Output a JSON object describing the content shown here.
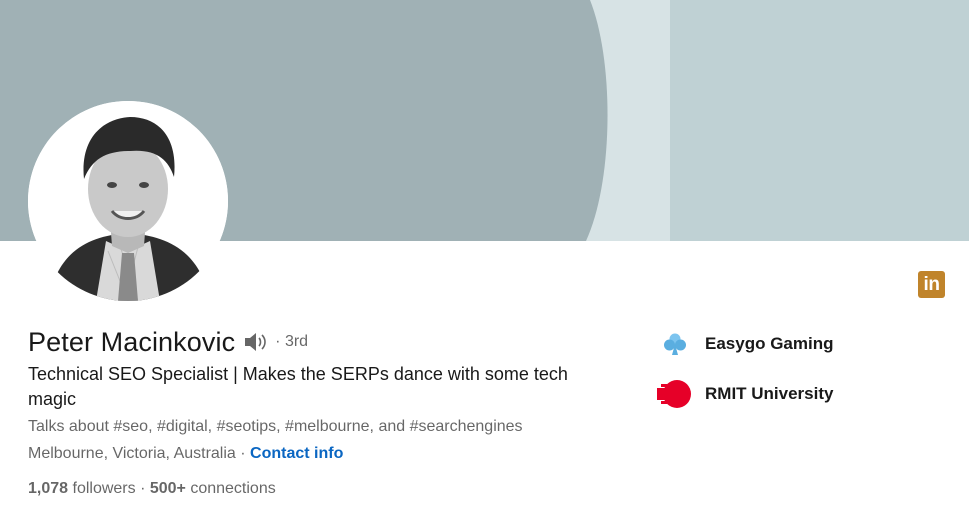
{
  "profile": {
    "name": "Peter Macinkovic",
    "degree": "· 3rd",
    "headline": "Technical SEO Specialist | Makes the SERPs dance with some tech magic",
    "talks_about": "Talks about #seo, #digital, #seotips, #melbourne, and #searchengines",
    "location": "Melbourne, Victoria, Australia",
    "location_separator": " · ",
    "contact_info_label": "Contact info",
    "followers_count": "1,078",
    "followers_label": " followers",
    "connections_separator": " · ",
    "connections_count": "500+",
    "connections_label": " connections"
  },
  "badge": {
    "text": "in",
    "color": "#c0842b"
  },
  "experience": [
    {
      "name": "Easygo Gaming",
      "logo_icon": "clover-icon",
      "color": "#6ab7e8"
    },
    {
      "name": "RMIT University",
      "logo_icon": "rmit-logo-icon",
      "color": "#e60028"
    }
  ],
  "colors": {
    "link": "#0a66c2",
    "banner_dark": "#a0b1b5",
    "banner_light": "#bfd1d4",
    "banner_mid": "#d7e3e5"
  },
  "icons": {
    "pronunciation": "speaker-icon"
  }
}
